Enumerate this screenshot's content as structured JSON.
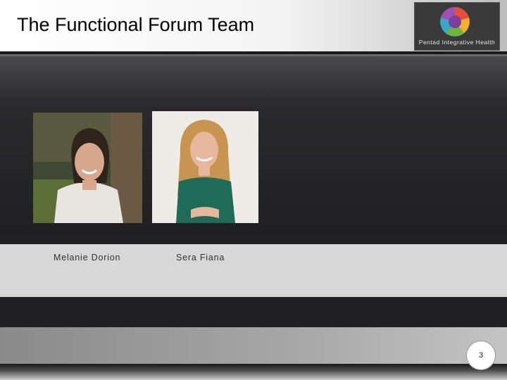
{
  "slide": {
    "title": "The Functional Forum Team",
    "page_number": "3"
  },
  "logo": {
    "text": "Pentad Integrative Health",
    "icon": "puzzle-circle-logo-icon"
  },
  "team": [
    {
      "name": "Melanie Dorion",
      "photo": "portrait-photo"
    },
    {
      "name": "Sera Fiana",
      "photo": "portrait-photo"
    }
  ]
}
